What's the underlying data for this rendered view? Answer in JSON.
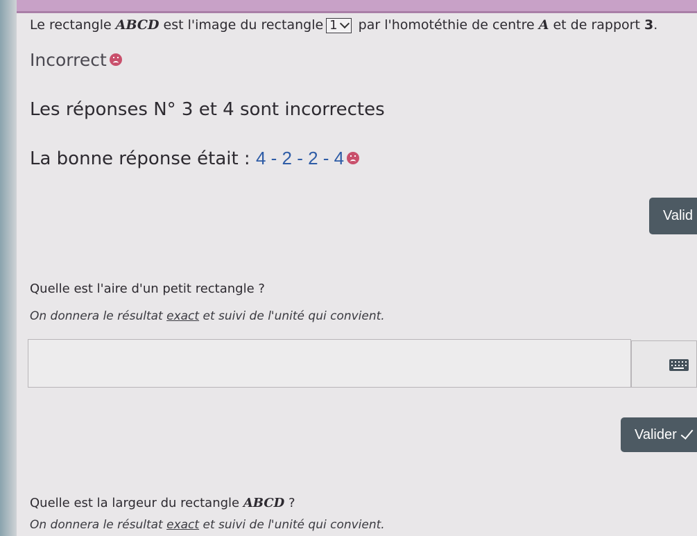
{
  "question1": {
    "prefix": "Le rectangle ",
    "math_shape": "ABCD",
    "middle": " est l'image du rectangle",
    "dropdown_value": "1",
    "suffix_before": " par l'homotéthie de centre ",
    "math_center": "A",
    "suffix_after": " et de rapport ",
    "ratio": "3",
    "end": "."
  },
  "feedback": {
    "status": "Incorrect",
    "wrong_prefix": "Les réponses ",
    "wrong_numbers": "N° 3 et 4",
    "wrong_suffix": " sont incorrectes",
    "good_prefix": "La bonne réponse était : ",
    "good_answer": "4 - 2 - 2 - 4"
  },
  "buttons": {
    "validate_truncated": "Valid",
    "validate": "Valider"
  },
  "question2": {
    "text": "Quelle est l'aire d'un petit rectangle ?",
    "hint_prefix": "On donnera le résultat ",
    "hint_underlined": "exact",
    "hint_suffix": " et suivi de l'unité qui convient.",
    "input_value": ""
  },
  "question3": {
    "prefix": "Quelle est la largeur du rectangle ",
    "math_shape": "ABCD",
    "suffix": " ?",
    "hint_prefix": "On donnera le résultat ",
    "hint_underlined": "exact",
    "hint_suffix": " et suivi de l'unité qui convient."
  },
  "icons": {
    "sad": "sad-face-icon",
    "keyboard": "keyboard-icon",
    "check": "check-icon",
    "dropdown": "chevron-down-icon"
  },
  "colors": {
    "header_band": "#c8a1c7",
    "answer_blue": "#2e5ca6",
    "error_red": "#c9506c",
    "button": "#4d5a63"
  }
}
